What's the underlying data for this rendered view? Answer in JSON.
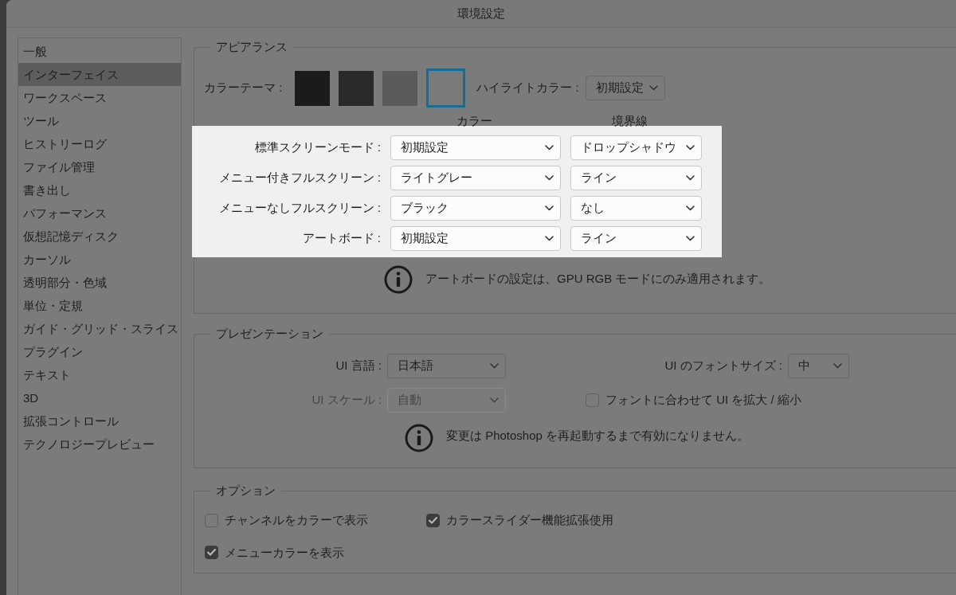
{
  "window": {
    "title": "環境設定"
  },
  "sidebar": {
    "items": [
      {
        "label": "一般",
        "selected": false
      },
      {
        "label": "インターフェイス",
        "selected": true
      },
      {
        "label": "ワークスペース",
        "selected": false
      },
      {
        "label": "ツール",
        "selected": false
      },
      {
        "label": "ヒストリーログ",
        "selected": false
      },
      {
        "label": "ファイル管理",
        "selected": false
      },
      {
        "label": "書き出し",
        "selected": false
      },
      {
        "label": "パフォーマンス",
        "selected": false
      },
      {
        "label": "仮想記憶ディスク",
        "selected": false
      },
      {
        "label": "カーソル",
        "selected": false
      },
      {
        "label": "透明部分・色域",
        "selected": false
      },
      {
        "label": "単位・定規",
        "selected": false
      },
      {
        "label": "ガイド・グリッド・スライス",
        "selected": false
      },
      {
        "label": "プラグイン",
        "selected": false
      },
      {
        "label": "テキスト",
        "selected": false
      },
      {
        "label": "3D",
        "selected": false
      },
      {
        "label": "拡張コントロール",
        "selected": false
      },
      {
        "label": "テクノロジープレビュー",
        "selected": false
      }
    ]
  },
  "appearance": {
    "title": "アピアランス",
    "color_theme": {
      "label": "カラーテーマ :",
      "swatches": [
        {
          "color": "#1b1b1b",
          "selected": false
        },
        {
          "color": "#2a2a2a",
          "selected": false
        },
        {
          "color": "#5b5b5b",
          "selected": false
        },
        {
          "color": "#7a7a7a",
          "selected": true
        }
      ]
    },
    "highlight_color": {
      "label": "ハイライトカラー :",
      "value": "初期設定"
    },
    "screen_modes": {
      "highlighted": true,
      "headers": [
        "カラー",
        "境界線"
      ],
      "rows": [
        {
          "label": "標準スクリーンモード :",
          "color_value": "初期設定",
          "border_value": "ドロップシャドウ"
        },
        {
          "label": "メニュー付きフルスクリーン :",
          "color_value": "ライトグレー",
          "border_value": "ライン"
        },
        {
          "label": "メニューなしフルスクリーン :",
          "color_value": "ブラック",
          "border_value": "なし"
        },
        {
          "label": "アートボード :",
          "color_value": "初期設定",
          "border_value": "ライン"
        }
      ]
    },
    "note": "アートボードの設定は、GPU RGB モードにのみ適用されます。"
  },
  "presentation": {
    "title": "プレゼンテーション",
    "ui_language": {
      "label": "UI 言語 :",
      "value": "日本語"
    },
    "font_size": {
      "label": "UI のフォントサイズ :",
      "value": "中"
    },
    "ui_scale": {
      "label": "UI スケール :",
      "value": "自動",
      "disabled": true
    },
    "scale_with_font": {
      "label": "フォントに合わせて UI を拡大 / 縮小",
      "checked": false
    },
    "note": "変更は Photoshop を再起動するまで有効になりません。"
  },
  "options": {
    "title": "オプション",
    "checkboxes": [
      {
        "label": "チャンネルをカラーで表示",
        "checked": false
      },
      {
        "label": "カラースライダー機能拡張使用",
        "checked": true
      },
      {
        "label": "メニューカラーを表示",
        "checked": true
      }
    ]
  }
}
